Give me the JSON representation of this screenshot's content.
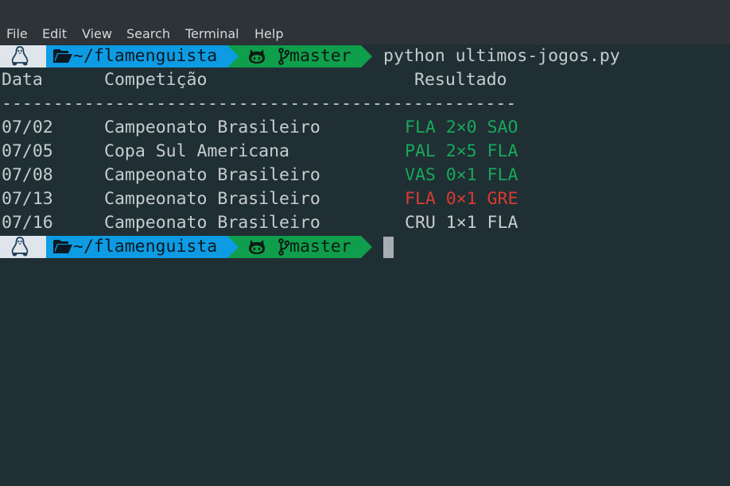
{
  "menu": {
    "items": [
      {
        "label": "File"
      },
      {
        "label": "Edit"
      },
      {
        "label": "View"
      },
      {
        "label": "Search"
      },
      {
        "label": "Terminal"
      },
      {
        "label": "Help"
      }
    ]
  },
  "prompt": {
    "directory": "~/flamenguista",
    "branch": "master",
    "command": "python ultimos-jogos.py",
    "icons": {
      "os": "linux-tux-icon",
      "folder": "folder-open-icon",
      "github": "github-octocat-icon",
      "branch": "git-branch-icon"
    }
  },
  "table": {
    "headers": {
      "date": "Data",
      "competition": "Competição",
      "result": "Resultado"
    },
    "separator": "--------------------------------------------------",
    "rows": [
      {
        "date": "07/02",
        "competition": "Campeonato Brasileiro",
        "result": "FLA 2×0 SAO",
        "status": "win"
      },
      {
        "date": "07/05",
        "competition": "Copa Sul Americana",
        "result": "PAL 2×5 FLA",
        "status": "win"
      },
      {
        "date": "07/08",
        "competition": "Campeonato Brasileiro",
        "result": "VAS 0×1 FLA",
        "status": "win"
      },
      {
        "date": "07/13",
        "competition": "Campeonato Brasileiro",
        "result": "FLA 0×1 GRE",
        "status": "loss"
      },
      {
        "date": "07/16",
        "competition": "Campeonato Brasileiro",
        "result": "CRU 1×1 FLA",
        "status": "draw"
      }
    ]
  },
  "colors": {
    "background": "#1f2f33",
    "win": "#18a85c",
    "loss": "#d93b32",
    "draw": "#c7cdcf",
    "dir_segment": "#0d9be3",
    "git_segment": "#0f9f4c"
  }
}
